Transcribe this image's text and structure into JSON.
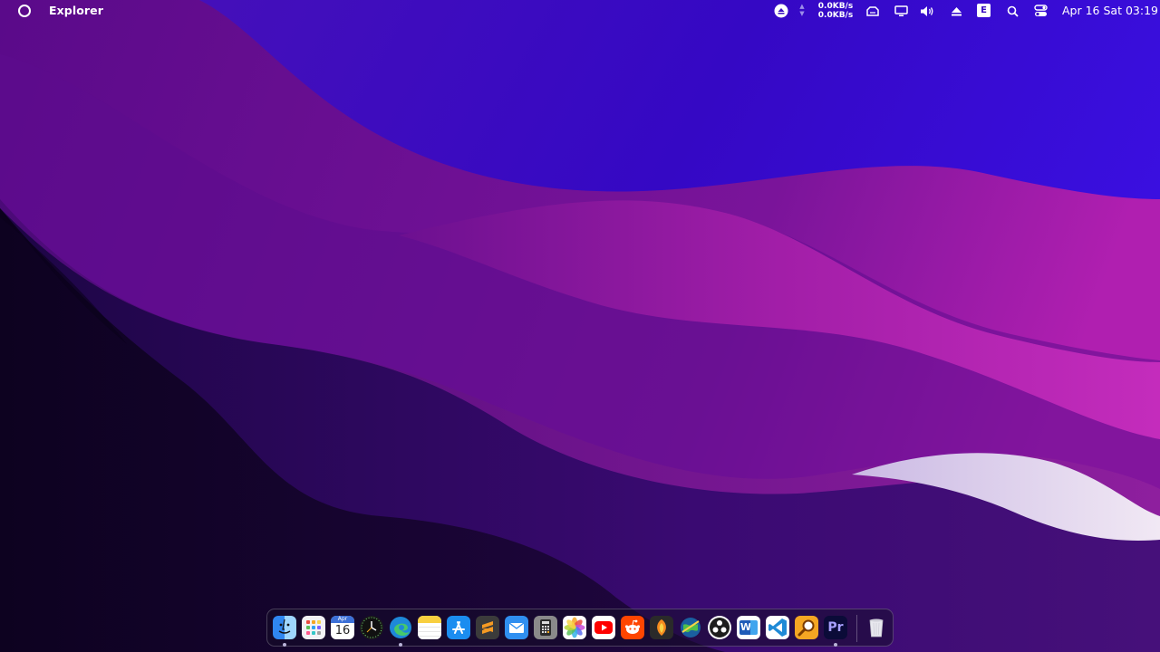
{
  "menubar": {
    "app_title": "Explorer",
    "net_up": "0.0KB/s",
    "net_down": "0.0KB/s",
    "up_arrow": "▲",
    "down_arrow": "▼",
    "badge_letter": "E",
    "clock": "Apr 16 Sat 03:19"
  },
  "dock": {
    "calendar_month": "Apr",
    "calendar_day": "16",
    "premiere_label": "Pr",
    "word_label": "W"
  },
  "colors": {
    "sky": "#3a08c8",
    "magenta": "#b21ca8",
    "deep_purple": "#2a0660",
    "dark": "#0e0221"
  }
}
